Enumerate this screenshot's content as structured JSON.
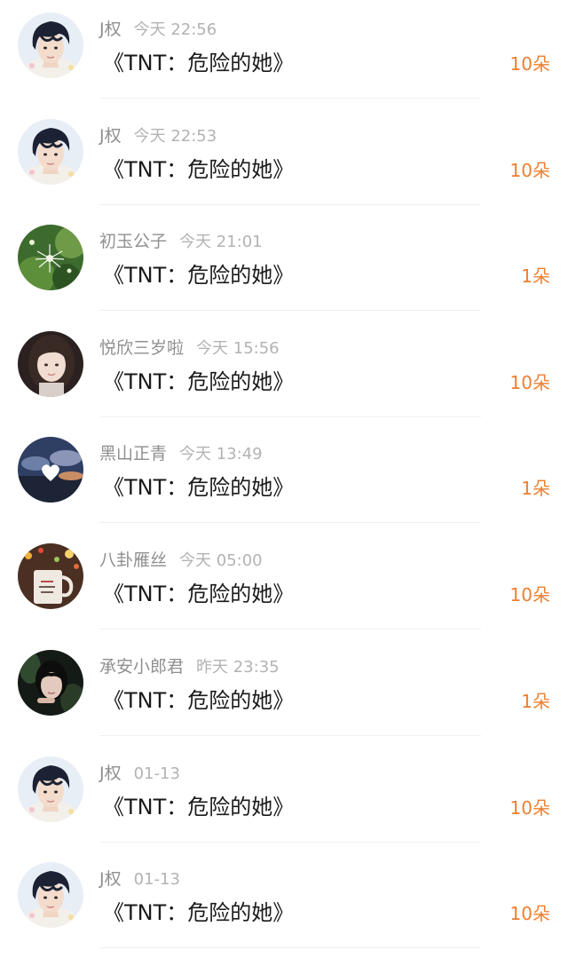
{
  "items": [
    {
      "name": "J权",
      "time": "今天 22:56",
      "title": "《TNT：危险的她》",
      "count": "10朵",
      "avatar": "boy-icon"
    },
    {
      "name": "J权",
      "time": "今天 22:53",
      "title": "《TNT：危险的她》",
      "count": "10朵",
      "avatar": "boy-icon"
    },
    {
      "name": "初玉公子",
      "time": "今天 21:01",
      "title": "《TNT：危险的她》",
      "count": "1朵",
      "avatar": "dandelion-icon"
    },
    {
      "name": "悦欣三岁啦",
      "time": "今天 15:56",
      "title": "《TNT：危险的她》",
      "count": "10朵",
      "avatar": "girl-icon"
    },
    {
      "name": "黑山正青",
      "time": "今天 13:49",
      "title": "《TNT：危险的她》",
      "count": "1朵",
      "avatar": "heart-sky-icon"
    },
    {
      "name": "八卦雁丝",
      "time": "今天 05:00",
      "title": "《TNT：危险的她》",
      "count": "10朵",
      "avatar": "mug-icon"
    },
    {
      "name": "承安小郎君",
      "time": "昨天 23:35",
      "title": "《TNT：危险的她》",
      "count": "1朵",
      "avatar": "dark-portrait-icon"
    },
    {
      "name": "J权",
      "time": "01-13",
      "title": "《TNT：危险的她》",
      "count": "10朵",
      "avatar": "boy-icon"
    },
    {
      "name": "J权",
      "time": "01-13",
      "title": "《TNT：危险的她》",
      "count": "10朵",
      "avatar": "boy-icon"
    }
  ],
  "colors": {
    "accent": "#ed7f30",
    "name": "#8f8f8f",
    "time": "#b3b3b3",
    "title": "#1a1a1a"
  }
}
